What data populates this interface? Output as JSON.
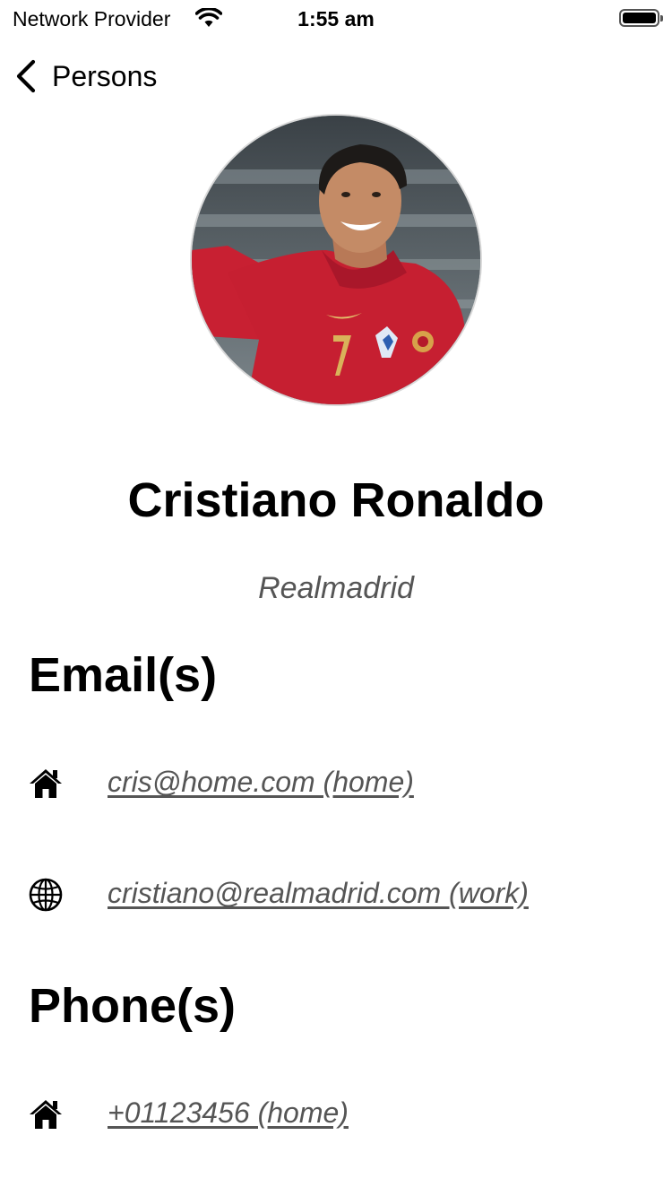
{
  "status_bar": {
    "carrier": "Network Provider",
    "time": "1:55 am",
    "battery_level": 1.0
  },
  "nav": {
    "back_label": "Persons"
  },
  "profile": {
    "name": "Cristiano Ronaldo",
    "subtitle": "Realmadrid"
  },
  "emails": {
    "title": "Email(s)",
    "items": [
      {
        "icon": "home-icon",
        "text": "cris@home.com (home)"
      },
      {
        "icon": "globe-icon",
        "text": "cristiano@realmadrid.com (work)"
      }
    ]
  },
  "phones": {
    "title": "Phone(s)",
    "items": [
      {
        "icon": "home-icon",
        "text": "+01123456 (home)"
      }
    ]
  }
}
